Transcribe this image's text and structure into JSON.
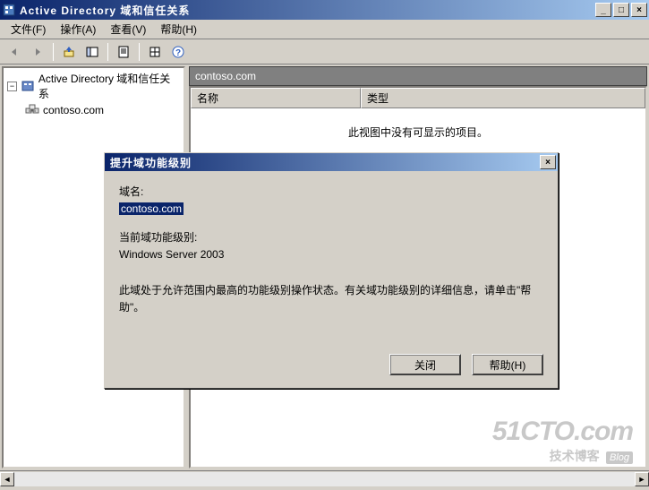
{
  "window": {
    "title": "Active Directory 域和信任关系",
    "controls": {
      "min": "_",
      "max": "□",
      "close": "×"
    }
  },
  "menubar": {
    "file": "文件(F)",
    "action": "操作(A)",
    "view": "查看(V)",
    "help": "帮助(H)"
  },
  "tree": {
    "root": "Active Directory 域和信任关系",
    "child": "contoso.com",
    "expand_symbol": "−"
  },
  "right": {
    "header": "contoso.com",
    "col1": "名称",
    "col2": "类型",
    "empty_msg": "此视图中没有可显示的项目。"
  },
  "dialog": {
    "title": "提升域功能级别",
    "domain_label": "域名:",
    "domain_value": "contoso.com",
    "level_label": "当前域功能级别:",
    "level_value": "Windows Server 2003",
    "message": "此域处于允许范围内最高的功能级别操作状态。有关域功能级别的详细信息，请单击\"帮助\"。",
    "close_btn": "关闭",
    "help_btn": "帮助(H)",
    "close_x": "×"
  },
  "watermark": {
    "main": "51CTO.com",
    "sub": "技术博客",
    "blog": "Blog"
  }
}
